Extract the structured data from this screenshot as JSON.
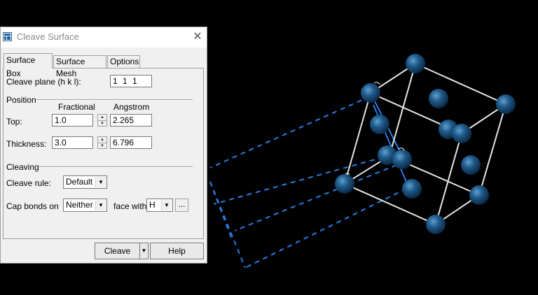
{
  "dialog": {
    "title": "Cleave Surface",
    "close_glyph": "✕",
    "tabs": [
      {
        "label": "Surface Box",
        "active": true
      },
      {
        "label": "Surface Mesh",
        "active": false
      },
      {
        "label": "Options",
        "active": false
      }
    ],
    "cleave_plane": {
      "label": "Cleave plane (h k l):",
      "value": "1 1 1"
    },
    "position": {
      "group_label": "Position",
      "col_fractional": "Fractional",
      "col_angstrom": "Angstrom",
      "top": {
        "label": "Top:",
        "fractional": "1.0",
        "angstrom": "2.265"
      },
      "thickness": {
        "label": "Thickness:",
        "fractional": "3.0",
        "angstrom": "6.796"
      }
    },
    "cleaving": {
      "group_label": "Cleaving",
      "cleave_rule_label": "Cleave rule:",
      "cleave_rule_value": "Default",
      "cap_bonds_label": "Cap bonds on",
      "cap_bonds_value": "Neither",
      "face_with_label": "face with",
      "face_with_value": "H",
      "more_button": "..."
    },
    "buttons": {
      "cleave": "Cleave",
      "help": "Help"
    }
  },
  "viewport": {
    "background": "#000000",
    "atom_color": "#1f5a8a",
    "bond_color": "#e6e6e6",
    "surface_box_color": "#2a7de1",
    "atom_count": 14
  }
}
